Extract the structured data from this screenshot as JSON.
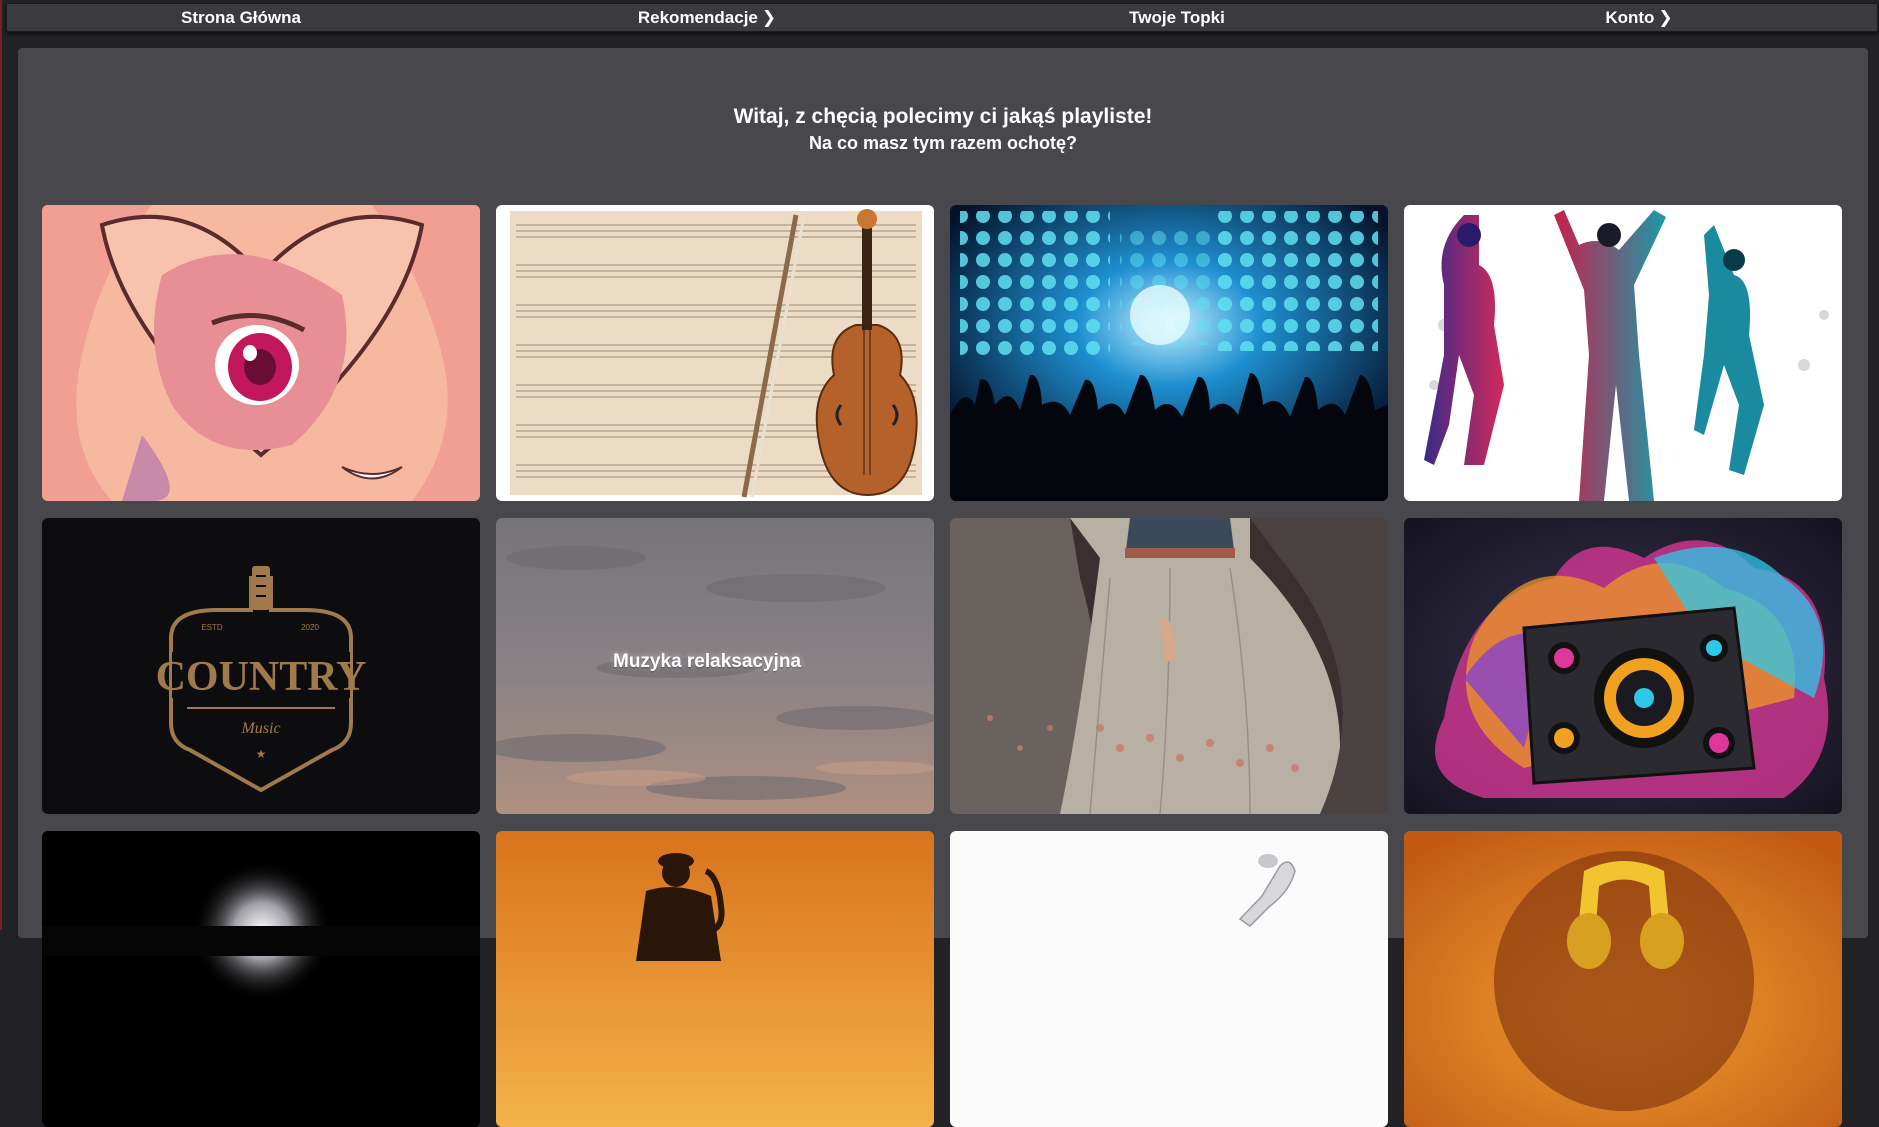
{
  "nav": {
    "items": [
      {
        "label": "Strona Główna",
        "has_chevron": false
      },
      {
        "label": "Rekomendacje",
        "has_chevron": true
      },
      {
        "label": "Twoje Topki",
        "has_chevron": false
      },
      {
        "label": "Konto",
        "has_chevron": true
      }
    ],
    "chevron_glyph": "❯"
  },
  "main": {
    "greeting": "Witaj, z chęcią polecimy ci jakąś playliste!",
    "question": "Na co masz tym razem ochotę?"
  },
  "tiles": [
    {
      "id": "anime",
      "label": ""
    },
    {
      "id": "classical-violin",
      "label": ""
    },
    {
      "id": "concert-crowd",
      "label": ""
    },
    {
      "id": "dance-silhouettes",
      "label": ""
    },
    {
      "id": "country",
      "label": "",
      "logo_text": "COUNTRY",
      "logo_sub": "Music",
      "logo_estd": "ESTD",
      "logo_year": "2020"
    },
    {
      "id": "relax",
      "label": "Muzyka relaksacyjna"
    },
    {
      "id": "folk-dresses",
      "label": ""
    },
    {
      "id": "speaker-splash",
      "label": ""
    },
    {
      "id": "dark-stage",
      "label": ""
    },
    {
      "id": "saxophone-sunset",
      "label": ""
    },
    {
      "id": "white-dancer",
      "label": ""
    },
    {
      "id": "headphones-afro",
      "label": ""
    }
  ],
  "colors": {
    "page_bg": "#222226",
    "nav_bg": "#3a3a3f",
    "panel_bg": "#48484c",
    "text": "#ffffff",
    "country_gold": "#a07a4a"
  }
}
